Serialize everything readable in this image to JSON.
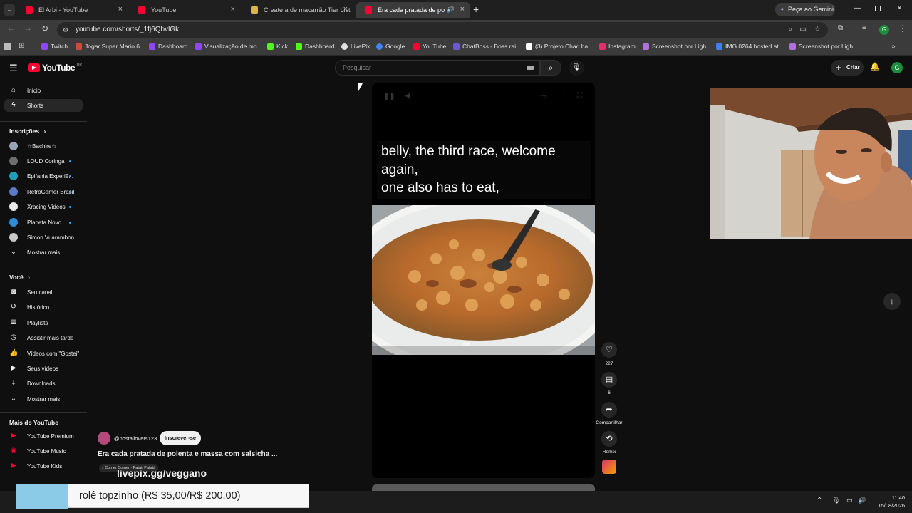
{
  "browser": {
    "tabs": [
      {
        "label": "El Arbi - YouTube",
        "icon": "youtube-icon",
        "color": "#ff0033"
      },
      {
        "label": "YouTube",
        "icon": "youtube-icon",
        "color": "#ff0033"
      },
      {
        "label": "Create a de macarrão Tier List",
        "icon": "tierlist-icon",
        "color": "#d9b64a"
      },
      {
        "label": "Era cada pratada de polent",
        "icon": "youtube-icon",
        "color": "#ff0033"
      }
    ],
    "gemini_label": "Peça ao Gemini",
    "url": "youtube.com/shorts/_1fj6QbvlGk",
    "profile_initial": "G",
    "bookmarks": [
      {
        "label": "Twitch",
        "color": "#9146ff"
      },
      {
        "label": "Jogar Super Mario 6...",
        "color": "#d04a3a"
      },
      {
        "label": "Dashboard",
        "color": "#9146ff"
      },
      {
        "label": "Visualização de mo...",
        "color": "#9146ff"
      },
      {
        "label": "Kick",
        "color": "#53fc18"
      },
      {
        "label": "Dashboard",
        "color": "#53fc18"
      },
      {
        "label": "LivePix",
        "color": "#e0e0e0"
      },
      {
        "label": "Google",
        "color": "#4285f4"
      },
      {
        "label": "YouTube",
        "color": "#ff0033"
      },
      {
        "label": "ChatBoss - Boss rai...",
        "color": "#6a5acd"
      },
      {
        "label": "(3) Projeto Chad ba...",
        "color": "#ffffff"
      },
      {
        "label": "Instagram",
        "color": "#e1306c"
      },
      {
        "label": "Screenshot por Ligh...",
        "color": "#b070e0"
      },
      {
        "label": "IMG 0264 hosted at...",
        "color": "#3b82f6"
      },
      {
        "label": "Screenshot por Ligh...",
        "color": "#b070e0"
      }
    ]
  },
  "youtube": {
    "logo_text": "YouTube",
    "logo_region": "BR",
    "search_placeholder": "Pesquisar",
    "create_label": "Criar",
    "avatar_initial": "G",
    "sidebar": {
      "main": [
        {
          "label": "Início",
          "icon": "home-icon"
        },
        {
          "label": "Shorts",
          "icon": "shorts-icon"
        }
      ],
      "subscriptions_title": "Inscrições",
      "subscriptions": [
        {
          "label": "☆Bachire☆",
          "color": "#9aa3b3",
          "dot": false
        },
        {
          "label": "LOUD Coringa",
          "color": "#6d6d6d",
          "dot": true
        },
        {
          "label": "Epifania Experiê...",
          "color": "#1aa0b8",
          "dot": true
        },
        {
          "label": "RetroGamer Brasil",
          "color": "#5a7cc8",
          "dot": true
        },
        {
          "label": "Xracing Videos",
          "color": "#e8e8e8",
          "dot": true
        },
        {
          "label": "Planeta Novo",
          "color": "#2d8cd8",
          "dot": true
        },
        {
          "label": "Simon Vuarambon",
          "color": "#c8c8c8",
          "dot": false
        }
      ],
      "show_more": "Mostrar mais",
      "you_title": "Você",
      "you": [
        {
          "label": "Seu canal",
          "icon": "channel-icon"
        },
        {
          "label": "Histórico",
          "icon": "history-icon"
        },
        {
          "label": "Playlists",
          "icon": "playlists-icon"
        },
        {
          "label": "Assistir mais tarde",
          "icon": "watch-later-icon"
        },
        {
          "label": "Vídeos com \"Gostei\"",
          "icon": "liked-icon"
        },
        {
          "label": "Seus vídeos",
          "icon": "your-videos-icon"
        },
        {
          "label": "Downloads",
          "icon": "downloads-icon"
        }
      ],
      "show_more_2": "Mostrar mais",
      "more_title": "Mais do YouTube",
      "more": [
        {
          "label": "YouTube Premium",
          "icon": "youtube-premium-icon"
        },
        {
          "label": "YouTube Music",
          "icon": "youtube-music-icon"
        },
        {
          "label": "YouTube Kids",
          "icon": "youtube-kids-icon"
        }
      ]
    },
    "short": {
      "caption_lines": [
        "belly, the third race, welcome",
        "again,",
        "one also has to eat,"
      ],
      "channel_handle": "@nostallovers123",
      "subscribe_label": "Inscrever-se",
      "title": "Era cada pratada de polenta e massa com salsicha ...",
      "audio": "♪ Comer Comer · Patati Patatá",
      "likes": "227",
      "comments": "6",
      "share_label": "Compartilhar",
      "remix_label": "Remix"
    }
  },
  "overlay": {
    "livepix_url": "livepix.gg/veggano",
    "donation_text": "rolê topzinho (R$ 35,00/R$ 200,00)",
    "donation_progress": 0.175
  },
  "taskbar": {
    "time": "11:40",
    "date": "15/08/2026"
  }
}
